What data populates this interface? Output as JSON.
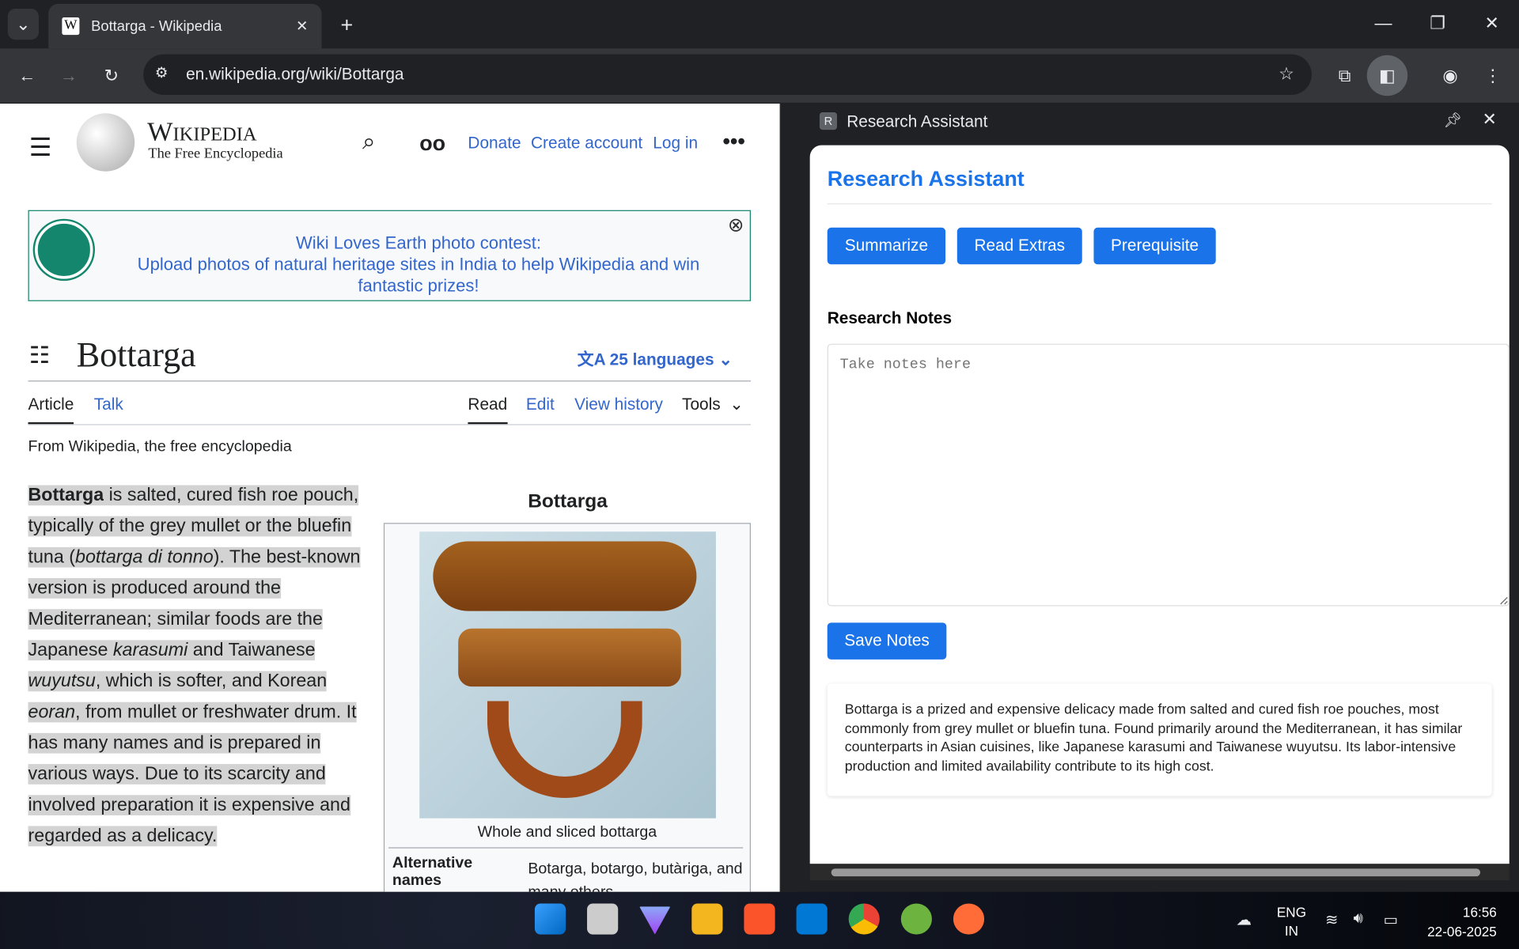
{
  "browser": {
    "tab_title": "Bottarga - Wikipedia",
    "url": "en.wikipedia.org/wiki/Bottarga"
  },
  "wiki": {
    "logo_title": "Wikipedia",
    "logo_sub": "The Free Encyclopedia",
    "nav": {
      "donate": "Donate",
      "create": "Create account",
      "login": "Log in"
    },
    "banner": {
      "line1": "Wiki Loves Earth photo contest:",
      "line2": "Upload photos of natural heritage sites in India to help Wikipedia and win fantastic prizes!"
    },
    "title": "Bottarga",
    "languages": "25 languages",
    "tabs": {
      "article": "Article",
      "talk": "Talk",
      "read": "Read",
      "edit": "Edit",
      "history": "View history",
      "tools": "Tools"
    },
    "from": "From Wikipedia, the free encyclopedia",
    "para": [
      {
        "t": "Bottarga",
        "s": "b"
      },
      {
        "t": " is salted, cured fish roe pouch, typically of the grey mullet or the bluefin tuna (",
        "s": ""
      },
      {
        "t": "bottarga di tonno",
        "s": "i"
      },
      {
        "t": "). The best-known version is produced around the Mediterranean; similar foods are the Japanese ",
        "s": ""
      },
      {
        "t": "karasumi",
        "s": "i"
      },
      {
        "t": " and Taiwanese ",
        "s": ""
      },
      {
        "t": "wuyutsu",
        "s": "i"
      },
      {
        "t": ", which is softer, and Korean ",
        "s": ""
      },
      {
        "t": "eoran",
        "s": "i"
      },
      {
        "t": ", from mullet or freshwater drum. It has many names and is prepared in various ways. Due to its scarcity and involved preparation it is expensive and regarded as a delicacy.",
        "s": ""
      }
    ],
    "infobox": {
      "title": "Bottarga",
      "caption": "Whole and sliced bottarga",
      "row_label": "Alternative names",
      "row_value": "Botarga, botargo, butàriga, and many others"
    }
  },
  "panel": {
    "header": "Research Assistant",
    "title": "Research Assistant",
    "buttons": {
      "summarize": "Summarize",
      "extras": "Read Extras",
      "prereq": "Prerequisite",
      "save": "Save Notes"
    },
    "notes_label": "Research Notes",
    "notes_placeholder": "Take notes here",
    "summary": "Bottarga is a prized and expensive delicacy made from salted and cured fish roe pouches, most commonly from grey mullet or bluefin tuna. Found primarily around the Mediterranean, it has similar counterparts in Asian cuisines, like Japanese karasumi and Taiwanese wuyutsu. Its labor-intensive production and limited availability contribute to its high cost."
  },
  "taskbar": {
    "lang1": "ENG",
    "lang2": "IN",
    "time": "16:56",
    "date": "22-06-2025"
  }
}
